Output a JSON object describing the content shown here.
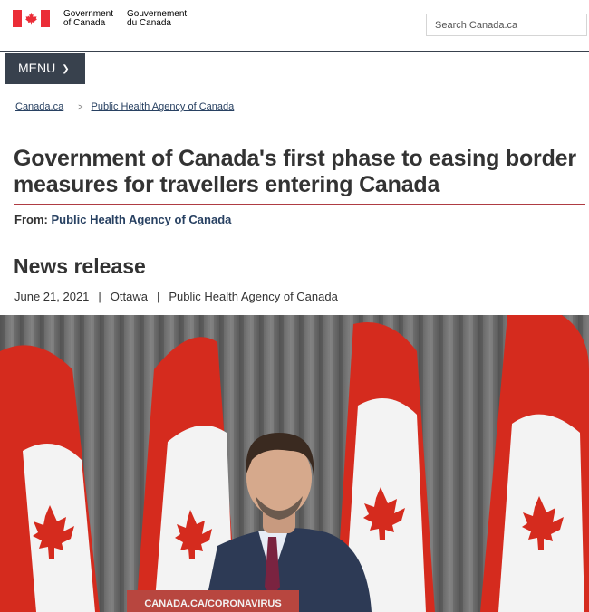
{
  "header": {
    "signature_en": [
      "Government",
      "of Canada"
    ],
    "signature_fr": [
      "Gouvernement",
      "du Canada"
    ],
    "search_placeholder": "Search Canada.ca"
  },
  "menu": {
    "label": "MENU"
  },
  "breadcrumb": {
    "items": [
      "Canada.ca",
      "Public Health Agency of Canada"
    ],
    "separator": ">"
  },
  "page": {
    "title": "Government of Canada's first phase to easing border measures for travellers entering Canada",
    "from_label": "From:",
    "from_link": "Public Health Agency of Canada",
    "section_heading": "News release",
    "meta": {
      "date": "June 21, 2021",
      "location": "Ottawa",
      "department": "Public Health Agency of Canada",
      "divider": "|"
    }
  },
  "photo": {
    "podium_text": "CANADA.CA/CORONAVIRUS"
  },
  "colors": {
    "flag_red": "#eb2d37",
    "menu_bg": "#38414d",
    "link": "#284162",
    "title_rule": "#af3c43"
  }
}
